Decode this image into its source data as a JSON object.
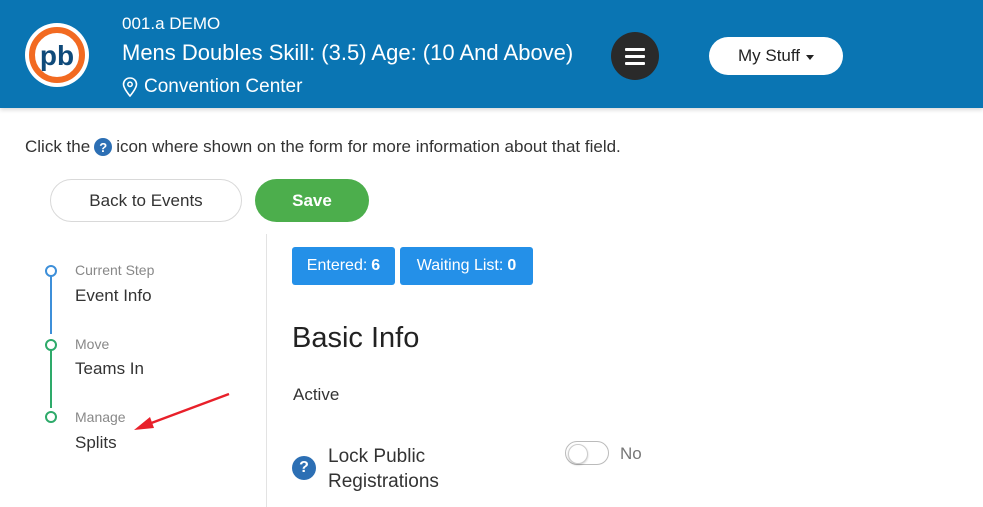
{
  "header": {
    "org": "001.a DEMO",
    "event_title": "Mens Doubles Skill: (3.5) Age: (10 And Above)",
    "venue": "Convention Center",
    "my_stuff_label": "My Stuff",
    "logo_text": "pb"
  },
  "info_text_before": "Click the",
  "info_text_after": "icon where shown on the form for more information about that field.",
  "buttons": {
    "back": "Back to Events",
    "save": "Save"
  },
  "stepper": [
    {
      "label": "Current Step",
      "value": "Event Info",
      "color": "#3d8fd9"
    },
    {
      "label": "Move",
      "value": "Teams In",
      "color": "#2eaa6a"
    },
    {
      "label": "Manage",
      "value": "Splits",
      "color": "#2eaa6a"
    }
  ],
  "badges": {
    "entered_label": "Entered:",
    "entered_count": "6",
    "waiting_label": "Waiting List:",
    "waiting_count": "0"
  },
  "section": {
    "title": "Basic Info",
    "active_label": "Active",
    "lock_label": "Lock Public Registrations",
    "lock_value": "No",
    "lock_enabled": false
  },
  "colors": {
    "header_bg": "#0a75b3",
    "save_bg": "#4cae4c",
    "badge_bg": "#2490e8",
    "annotation_arrow": "#e8202a"
  },
  "help_icon_glyph": "?"
}
